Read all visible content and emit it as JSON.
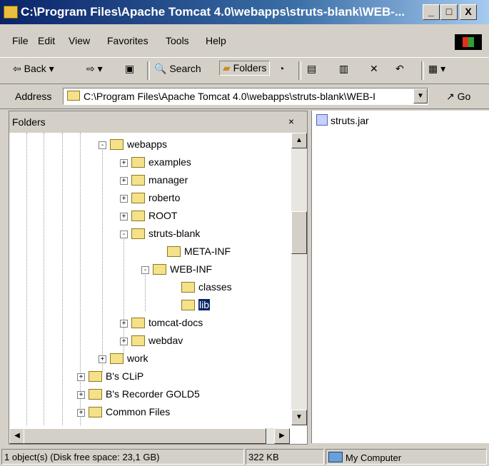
{
  "window": {
    "title": "C:\\Program Files\\Apache Tomcat 4.0\\webapps\\struts-blank\\WEB-...",
    "buttons": [
      "_",
      "□",
      "X"
    ]
  },
  "menubar": [
    "File",
    "Edit",
    "View",
    "Favorites",
    "Tools",
    "Help"
  ],
  "toolbar": {
    "back": "Back",
    "search": "Search",
    "folders": "Folders"
  },
  "address": {
    "label": "Address",
    "value": "C:\\Program Files\\Apache Tomcat 4.0\\webapps\\struts-blank\\WEB-I",
    "go": "Go"
  },
  "folders_pane": {
    "title": "Folders",
    "close": "×",
    "tree": [
      {
        "label": "webapps",
        "expander": "-",
        "selected": false
      },
      {
        "label": "examples",
        "expander": "+",
        "selected": false
      },
      {
        "label": "manager",
        "expander": "+",
        "selected": false
      },
      {
        "label": "roberto",
        "expander": "+",
        "selected": false
      },
      {
        "label": "ROOT",
        "expander": "+",
        "selected": false
      },
      {
        "label": "struts-blank",
        "expander": "-",
        "selected": false
      },
      {
        "label": "META-INF",
        "expander": "",
        "selected": false
      },
      {
        "label": "WEB-INF",
        "expander": "-",
        "selected": false
      },
      {
        "label": "classes",
        "expander": "",
        "selected": false
      },
      {
        "label": "lib",
        "expander": "",
        "selected": true
      },
      {
        "label": "tomcat-docs",
        "expander": "+",
        "selected": false
      },
      {
        "label": "webdav",
        "expander": "+",
        "selected": false
      },
      {
        "label": "work",
        "expander": "+",
        "selected": false
      },
      {
        "label": "B's CLiP",
        "expander": "+",
        "selected": false
      },
      {
        "label": "B's Recorder GOLD5",
        "expander": "+",
        "selected": false
      },
      {
        "label": "Common Files",
        "expander": "+",
        "selected": false
      }
    ]
  },
  "content": {
    "files": [
      {
        "name": "struts.jar",
        "icon": "jar-file-icon"
      }
    ]
  },
  "status": {
    "objects": "1 object(s) (Disk free space: 23,1 GB)",
    "size": "322 KB",
    "zone": "My Computer"
  }
}
